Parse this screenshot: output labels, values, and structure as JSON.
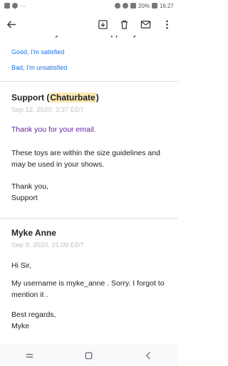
{
  "status_bar": {
    "battery": "20%",
    "time": "16:27"
  },
  "feedback": {
    "question_partial": "How would you rate the support you received?",
    "good_label": "Good, I'm satisfied",
    "bad_label": "Bad, I'm unsatisfied"
  },
  "messages": [
    {
      "sender_name": "Support",
      "sender_org_open": "(",
      "sender_org": "Chaturbate",
      "sender_org_close": ")",
      "date": "Sep 12, 2020, 3:37 EDT",
      "paragraphs": [
        "Thank you for your email.",
        "These toys are within the size guidelines and may be used in your shows.",
        "Thank you,\nSupport"
      ]
    },
    {
      "sender_name": "Myke Anne",
      "date": "Sep 9, 2020, 21:09 EDT",
      "paragraphs": [
        "Hi Sir,",
        "My username is myke_anne . Sorry. I forgot to mention it .",
        "Best regards,\nMyke"
      ]
    }
  ]
}
